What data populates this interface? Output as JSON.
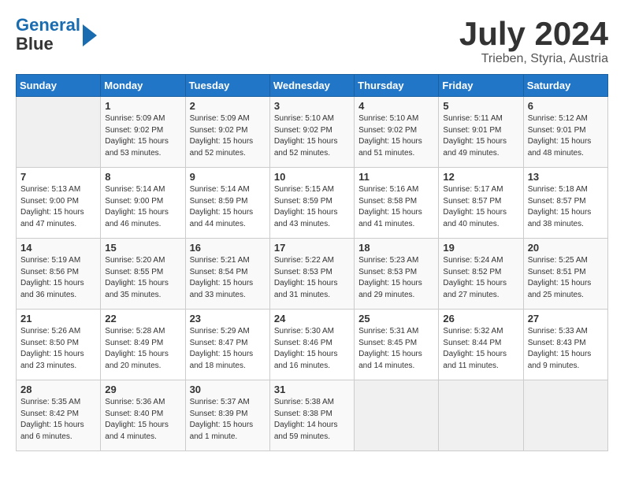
{
  "logo": {
    "line1": "General",
    "line2": "Blue"
  },
  "title": "July 2024",
  "location": "Trieben, Styria, Austria",
  "days_of_week": [
    "Sunday",
    "Monday",
    "Tuesday",
    "Wednesday",
    "Thursday",
    "Friday",
    "Saturday"
  ],
  "weeks": [
    [
      {
        "day": "",
        "info": ""
      },
      {
        "day": "1",
        "info": "Sunrise: 5:09 AM\nSunset: 9:02 PM\nDaylight: 15 hours\nand 53 minutes."
      },
      {
        "day": "2",
        "info": "Sunrise: 5:09 AM\nSunset: 9:02 PM\nDaylight: 15 hours\nand 52 minutes."
      },
      {
        "day": "3",
        "info": "Sunrise: 5:10 AM\nSunset: 9:02 PM\nDaylight: 15 hours\nand 52 minutes."
      },
      {
        "day": "4",
        "info": "Sunrise: 5:10 AM\nSunset: 9:02 PM\nDaylight: 15 hours\nand 51 minutes."
      },
      {
        "day": "5",
        "info": "Sunrise: 5:11 AM\nSunset: 9:01 PM\nDaylight: 15 hours\nand 49 minutes."
      },
      {
        "day": "6",
        "info": "Sunrise: 5:12 AM\nSunset: 9:01 PM\nDaylight: 15 hours\nand 48 minutes."
      }
    ],
    [
      {
        "day": "7",
        "info": "Sunrise: 5:13 AM\nSunset: 9:00 PM\nDaylight: 15 hours\nand 47 minutes."
      },
      {
        "day": "8",
        "info": "Sunrise: 5:14 AM\nSunset: 9:00 PM\nDaylight: 15 hours\nand 46 minutes."
      },
      {
        "day": "9",
        "info": "Sunrise: 5:14 AM\nSunset: 8:59 PM\nDaylight: 15 hours\nand 44 minutes."
      },
      {
        "day": "10",
        "info": "Sunrise: 5:15 AM\nSunset: 8:59 PM\nDaylight: 15 hours\nand 43 minutes."
      },
      {
        "day": "11",
        "info": "Sunrise: 5:16 AM\nSunset: 8:58 PM\nDaylight: 15 hours\nand 41 minutes."
      },
      {
        "day": "12",
        "info": "Sunrise: 5:17 AM\nSunset: 8:57 PM\nDaylight: 15 hours\nand 40 minutes."
      },
      {
        "day": "13",
        "info": "Sunrise: 5:18 AM\nSunset: 8:57 PM\nDaylight: 15 hours\nand 38 minutes."
      }
    ],
    [
      {
        "day": "14",
        "info": "Sunrise: 5:19 AM\nSunset: 8:56 PM\nDaylight: 15 hours\nand 36 minutes."
      },
      {
        "day": "15",
        "info": "Sunrise: 5:20 AM\nSunset: 8:55 PM\nDaylight: 15 hours\nand 35 minutes."
      },
      {
        "day": "16",
        "info": "Sunrise: 5:21 AM\nSunset: 8:54 PM\nDaylight: 15 hours\nand 33 minutes."
      },
      {
        "day": "17",
        "info": "Sunrise: 5:22 AM\nSunset: 8:53 PM\nDaylight: 15 hours\nand 31 minutes."
      },
      {
        "day": "18",
        "info": "Sunrise: 5:23 AM\nSunset: 8:53 PM\nDaylight: 15 hours\nand 29 minutes."
      },
      {
        "day": "19",
        "info": "Sunrise: 5:24 AM\nSunset: 8:52 PM\nDaylight: 15 hours\nand 27 minutes."
      },
      {
        "day": "20",
        "info": "Sunrise: 5:25 AM\nSunset: 8:51 PM\nDaylight: 15 hours\nand 25 minutes."
      }
    ],
    [
      {
        "day": "21",
        "info": "Sunrise: 5:26 AM\nSunset: 8:50 PM\nDaylight: 15 hours\nand 23 minutes."
      },
      {
        "day": "22",
        "info": "Sunrise: 5:28 AM\nSunset: 8:49 PM\nDaylight: 15 hours\nand 20 minutes."
      },
      {
        "day": "23",
        "info": "Sunrise: 5:29 AM\nSunset: 8:47 PM\nDaylight: 15 hours\nand 18 minutes."
      },
      {
        "day": "24",
        "info": "Sunrise: 5:30 AM\nSunset: 8:46 PM\nDaylight: 15 hours\nand 16 minutes."
      },
      {
        "day": "25",
        "info": "Sunrise: 5:31 AM\nSunset: 8:45 PM\nDaylight: 15 hours\nand 14 minutes."
      },
      {
        "day": "26",
        "info": "Sunrise: 5:32 AM\nSunset: 8:44 PM\nDaylight: 15 hours\nand 11 minutes."
      },
      {
        "day": "27",
        "info": "Sunrise: 5:33 AM\nSunset: 8:43 PM\nDaylight: 15 hours\nand 9 minutes."
      }
    ],
    [
      {
        "day": "28",
        "info": "Sunrise: 5:35 AM\nSunset: 8:42 PM\nDaylight: 15 hours\nand 6 minutes."
      },
      {
        "day": "29",
        "info": "Sunrise: 5:36 AM\nSunset: 8:40 PM\nDaylight: 15 hours\nand 4 minutes."
      },
      {
        "day": "30",
        "info": "Sunrise: 5:37 AM\nSunset: 8:39 PM\nDaylight: 15 hours\nand 1 minute."
      },
      {
        "day": "31",
        "info": "Sunrise: 5:38 AM\nSunset: 8:38 PM\nDaylight: 14 hours\nand 59 minutes."
      },
      {
        "day": "",
        "info": ""
      },
      {
        "day": "",
        "info": ""
      },
      {
        "day": "",
        "info": ""
      }
    ]
  ]
}
